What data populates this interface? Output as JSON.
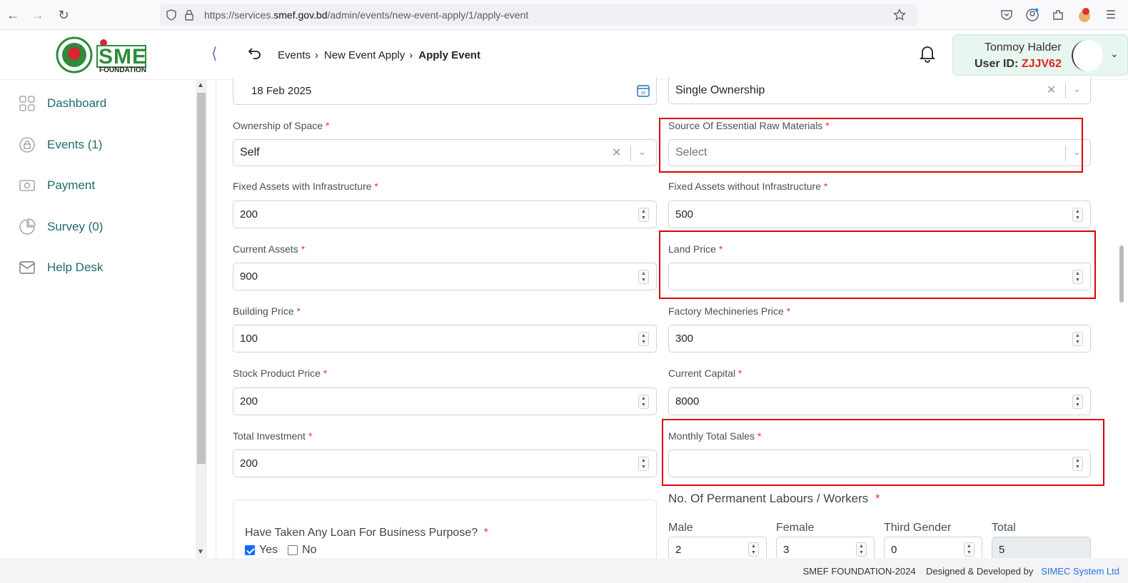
{
  "browser": {
    "url_prefix": "https://services.",
    "url_domain": "smef.gov.bd",
    "url_path": "/admin/events/new-event-apply/1/apply-event"
  },
  "header": {
    "logo_text": "SME",
    "logo_sub": "FOUNDATION",
    "breadcrumb": [
      "Events",
      "New Event Apply",
      "Apply Event"
    ],
    "user_name": "Tonmoy Halder",
    "user_id_label": "User ID:",
    "user_id_value": "ZJJV62"
  },
  "sidebar": {
    "items": [
      {
        "label": "Dashboard",
        "icon": "grid-icon"
      },
      {
        "label": "Events (1)",
        "icon": "lock-circle-icon"
      },
      {
        "label": "Payment",
        "icon": "cash-icon"
      },
      {
        "label": "Survey (0)",
        "icon": "pie-chart-icon"
      },
      {
        "label": "Help Desk",
        "icon": "mail-icon"
      }
    ]
  },
  "form": {
    "date_value": "18 Feb 2025",
    "ownership_type_value": "Single Ownership",
    "ownership_space": {
      "label": "Ownership of Space",
      "value": "Self"
    },
    "raw_materials": {
      "label": "Source Of Essential Raw Materials",
      "placeholder": "Select"
    },
    "fixed_with": {
      "label": "Fixed Assets with Infrastructure",
      "value": "200"
    },
    "fixed_without": {
      "label": "Fixed Assets without Infrastructure",
      "value": "500"
    },
    "current_assets": {
      "label": "Current Assets",
      "value": "900"
    },
    "land_price": {
      "label": "Land Price",
      "value": ""
    },
    "building_price": {
      "label": "Building Price",
      "value": "100"
    },
    "factory_price": {
      "label": "Factory Mechineries Price",
      "value": "300"
    },
    "stock_price": {
      "label": "Stock Product Price",
      "value": "200"
    },
    "current_capital": {
      "label": "Current Capital",
      "value": "8000"
    },
    "total_investment": {
      "label": "Total Investment",
      "value": "200"
    },
    "monthly_sales": {
      "label": "Monthly Total Sales",
      "value": ""
    },
    "workers": {
      "title": "No. Of Permanent Labours / Workers",
      "male": {
        "label": "Male",
        "value": "2"
      },
      "female": {
        "label": "Female",
        "value": "3"
      },
      "third": {
        "label": "Third Gender",
        "value": "0"
      },
      "total": {
        "label": "Total",
        "value": "5"
      }
    },
    "loan": {
      "question": "Have Taken Any Loan For Business Purpose?",
      "yes": "Yes",
      "no": "No"
    },
    "required_mark": "*"
  },
  "footer": {
    "copyright": "SMEF FOUNDATION-2024",
    "designed": "Designed & Developed by",
    "company": "SIMEC System Ltd"
  },
  "colors": {
    "accent": "#1d6b6b",
    "required": "#dc3545",
    "highlight": "#e00000"
  }
}
